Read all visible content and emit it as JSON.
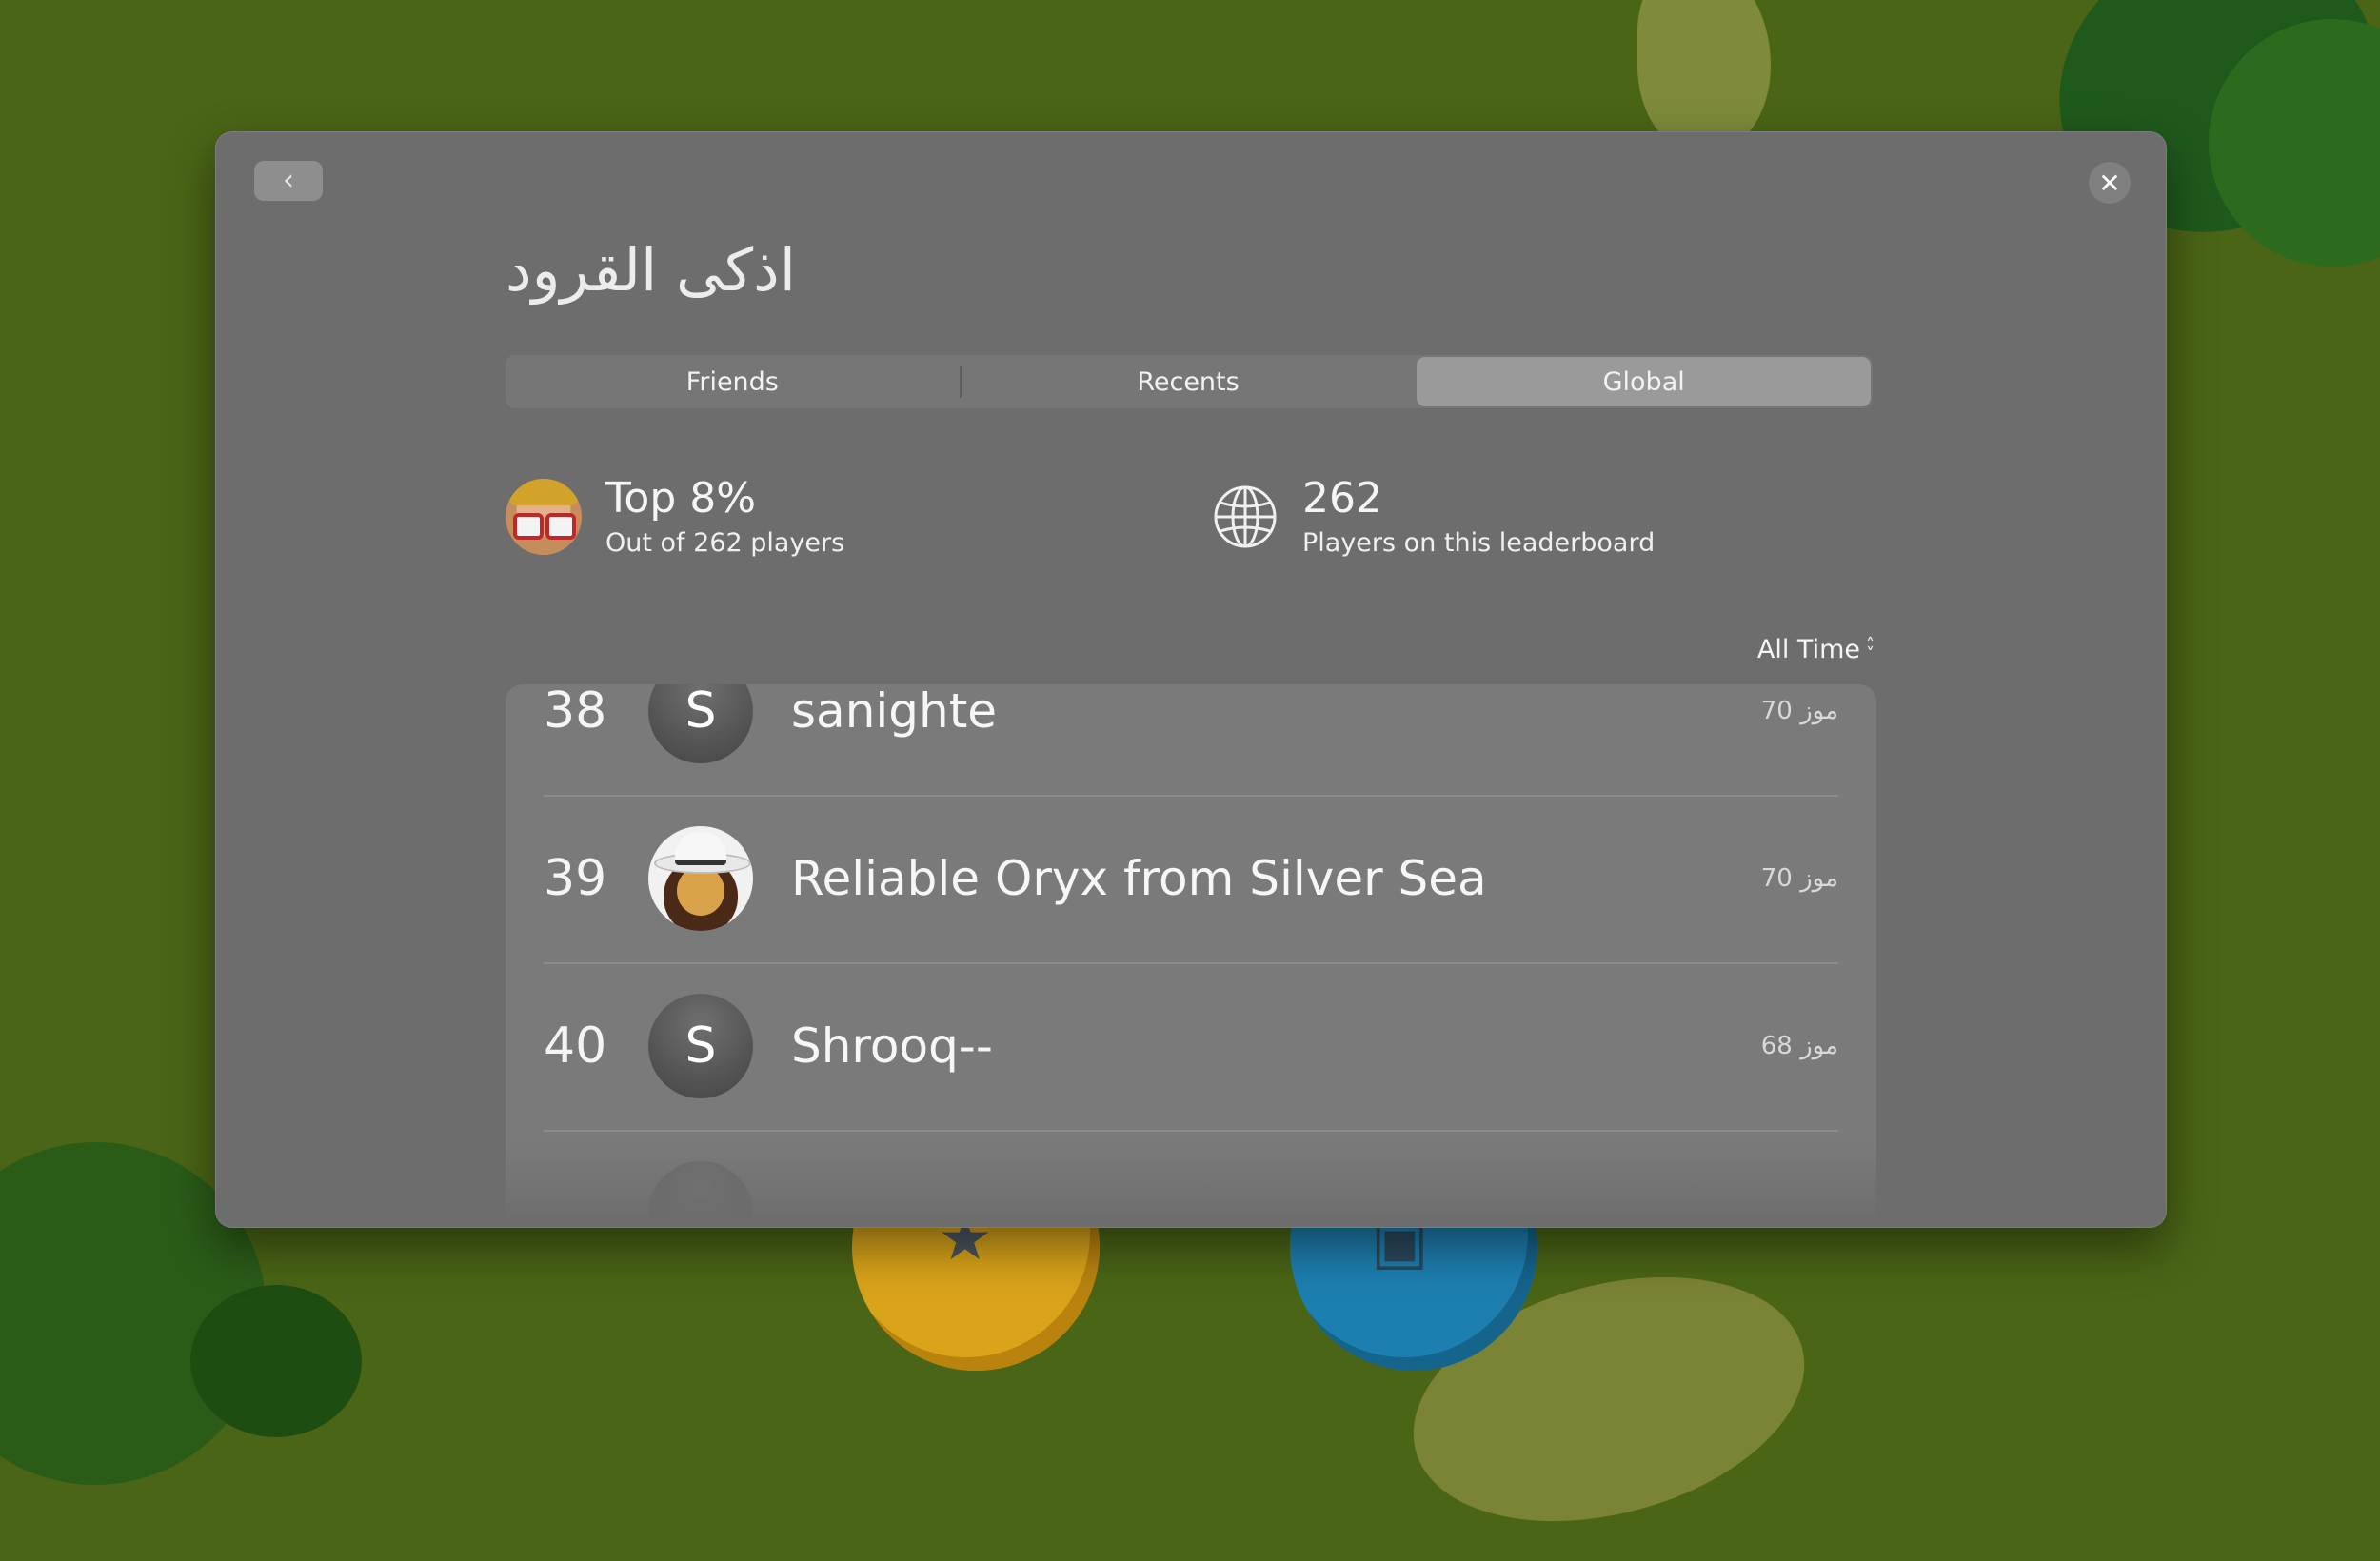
{
  "title": "اذكى القرود",
  "tabs": [
    {
      "label": "Friends",
      "selected": false
    },
    {
      "label": "Recents",
      "selected": false
    },
    {
      "label": "Global",
      "selected": true
    }
  ],
  "my_stat": {
    "headline": "Top 8%",
    "subtitle": "Out of 262 players"
  },
  "total_stat": {
    "headline": "262",
    "subtitle": "Players on this leaderboard"
  },
  "filter": {
    "label": "All Time"
  },
  "rows": [
    {
      "rank": "38",
      "initial": "S",
      "name": "sanighte",
      "score": "70 موز"
    },
    {
      "rank": "39",
      "initial": "",
      "name": "Reliable Oryx from Silver Sea",
      "score": "70 موز"
    },
    {
      "rank": "40",
      "initial": "S",
      "name": "Shrooq--",
      "score": "68 موز"
    }
  ],
  "colors": {
    "panel": "#6d6d6d",
    "list": "#7a7a7a",
    "background": "#4a6516",
    "selected_tab": "#9a9a9a"
  }
}
